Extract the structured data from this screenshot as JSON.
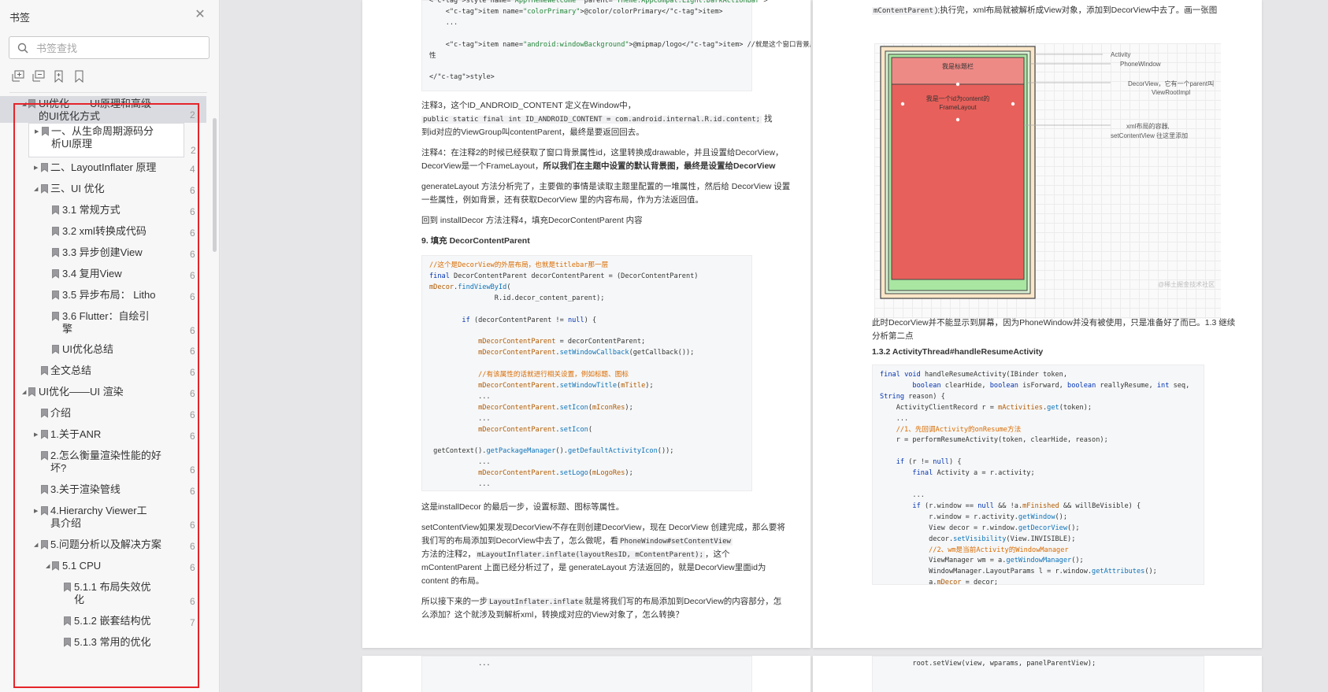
{
  "sidebar": {
    "title": "书签",
    "search_placeholder": "书签查找",
    "tree": [
      {
        "label": "UI优化——UI原理和高级",
        "label2": "的UI优化方式",
        "page": "2",
        "toggle": "▲",
        "active": true
      },
      {
        "label": "一、从生命周期源码分",
        "label2": "析UI原理",
        "page": "2",
        "toggle": "▶"
      },
      {
        "label": "二、LayoutInflater 原理",
        "page": "4",
        "toggle": "▶"
      },
      {
        "label": "三、UI 优化",
        "page": "6",
        "toggle": "▲"
      },
      {
        "label": "3.1 常规方式",
        "page": "6"
      },
      {
        "label": "3.2 xml转换成代码",
        "page": "6"
      },
      {
        "label": "3.3 异步创建View",
        "page": "6"
      },
      {
        "label": "3.4 复用View",
        "page": "6"
      },
      {
        "label": "3.5 异步布局： Litho",
        "page": "6"
      },
      {
        "label": "3.6 Flutter：自绘引",
        "label2": "擎",
        "page": "6"
      },
      {
        "label": "UI优化总结",
        "page": "6"
      },
      {
        "label": "全文总结",
        "page": "6"
      },
      {
        "label": "UI优化——UI 渲染",
        "page": "6",
        "toggle": "▲"
      },
      {
        "label": "介绍",
        "page": "6"
      },
      {
        "label": "1.关于ANR",
        "page": "6",
        "toggle": "▶"
      },
      {
        "label": "2.怎么衡量渲染性能的好",
        "label2": "坏?",
        "page": "6"
      },
      {
        "label": "3.关于渲染管线",
        "page": "6"
      },
      {
        "label": "4.Hierarchy Viewer工",
        "label2": "具介绍",
        "page": "6",
        "toggle": "▶"
      },
      {
        "label": "5.问题分析以及解决方案",
        "page": "6",
        "toggle": "▲"
      },
      {
        "label": "5.1 CPU",
        "page": "6",
        "toggle": "▲"
      },
      {
        "label": "5.1.1 布局失效优",
        "label2": "化",
        "page": "6"
      },
      {
        "label": "5.1.2 嵌套结构优",
        "page": "7"
      },
      {
        "label": "5.1.3 常用的优化",
        "page": ""
      }
    ]
  },
  "left_page": {
    "code1": [
      "<style name=\"AppThemeWelcome\" parent=\"Theme.AppCompat.Light.DarkActionBar\">",
      "    <item name=\"colorPrimary\">@color/colorPrimary</item>",
      "    ...",
      "",
      "    <item name=\"android:windowBackground\">@mipmap/logo</item> //就是这个窗口背景属",
      "性",
      "",
      "</style>"
    ],
    "note3_a": "注释3，这个ID_ANDROID_CONTENT 定义在Window中，",
    "note3_code": "public static final int ID_ANDROID_CONTENT = com.android.internal.R.id.content;",
    "note3_b": "找",
    "note3_c": "到id对应的ViewGroup叫contentParent，最终是要返回回去。",
    "note4_a": "注释4：在注释2的时候已经获取了窗口背景属性id，这里转换成drawable，并且设置给DecorView，",
    "note4_b": "DecorView是一个FrameLayout，",
    "note4_bold": "所以我们在主题中设置的默认背景图，最终是设置给DecorView",
    "gen_a": "generateLayout 方法分析完了，主要做的事情是读取主题里配置的一堆属性，然后给 DecorView 设置",
    "gen_b": "一些属性，例如背景，还有获取DecorView 里的内容布局，作为方法返回值。",
    "back": "回到 installDecor 方法注释4，填充DecorContentParent 内容",
    "heading9": "9. 填充 DecorContentParent",
    "code2": [
      "//这个是DecorView的外层布局，也就是titlebar那一层",
      "final DecorContentParent decorContentParent = (DecorContentParent)",
      "mDecor.findViewById(",
      "                R.id.decor_content_parent);",
      "",
      "        if (decorContentParent != null) {",
      "",
      "            mDecorContentParent = decorContentParent;",
      "            mDecorContentParent.setWindowCallback(getCallback());",
      "",
      "            //有该属性的话就进行相关设置，例如标题、图标",
      "            mDecorContentParent.setWindowTitle(mTitle);",
      "            ...",
      "            mDecorContentParent.setIcon(mIconRes);",
      "            ...",
      "            mDecorContentParent.setIcon(",
      "",
      " getContext().getPackageManager().getDefaultActivityIcon());",
      "            ...",
      "            mDecorContentParent.setLogo(mLogoRes);",
      "            ..."
    ],
    "p_last": "这是installDecor 的最后一步，设置标题、图标等属性。",
    "p_scv_1": "setContentView如果发现DecorView不存在则创建DecorView，现在 DecorView 创建完成，那么要将",
    "p_scv_2a": "我们写的布局添加到DecorView中去了，怎么做呢，看",
    "p_scv_2code": "PhoneWindow#setContentView",
    "p_scv_3a": "方法的注释2，",
    "p_scv_3code": "mLayoutInflater.inflate(layoutResID, mContentParent);",
    "p_scv_3b": "，这个",
    "p_scv_4": "mContentParent 上面已经分析过了，是 generateLayout 方法返回的，就是DecorView里面id为",
    "p_scv_5": "content 的布局。",
    "p_next_a": "所以接下来的一步",
    "p_next_code": "LayoutInflater.inflate",
    "p_next_b": "就是将我们写的布局添加到DecorView的内容部分，怎",
    "p_next_c": "么添加？这个就涉及到解析xml，转换成对应的View对象了，怎么转换？"
  },
  "right_page": {
    "top_code": "mContentParent",
    "top_text": ");执行完，xml布局就被解析成View对象，添加到DecorView中去了。画一张图",
    "diagram": {
      "title_bar": "我是标题栏",
      "content1": "我是一个id为content的",
      "content2": "FrameLayout",
      "labels": [
        "Activity",
        "PhoneWindow",
        "DecorView，它有一个parent叫",
        "ViewRootImpl",
        "xml布局的容器,",
        "setContentView 往这里添加"
      ],
      "watermark": "@稀土掘金技术社区"
    },
    "para1": "此时DecorView并不能显示到屏幕，因为PhoneWindow并没有被使用，只是准备好了而已。1.3 继续",
    "para2": "分析第二点",
    "heading": "1.3.2 ActivityThread#handleResumeActivity",
    "code": [
      "final void handleResumeActivity(IBinder token,",
      "        boolean clearHide, boolean isForward, boolean reallyResume, int seq,",
      "String reason) {",
      "    ActivityClientRecord r = mActivities.get(token);",
      "    ...",
      "    //1、先回调Activity的onResume方法",
      "    r = performResumeActivity(token, clearHide, reason);",
      "",
      "    if (r != null) {",
      "        final Activity a = r.activity;",
      "",
      "        ...",
      "        if (r.window == null && !a.mFinished && willBeVisible) {",
      "            r.window = r.activity.getWindow();",
      "            View decor = r.window.getDecorView();",
      "            decor.setVisibility(View.INVISIBLE);",
      "            //2、wm是当前Activity的WindowManager",
      "            ViewManager wm = a.getWindowManager();",
      "            WindowManager.LayoutParams l = r.window.getAttributes();",
      "            a.mDecor = decor;"
    ],
    "bottom_left_code": "            ...",
    "bottom_right_code": "        root.setView(view, wparams, panelParentView);"
  }
}
